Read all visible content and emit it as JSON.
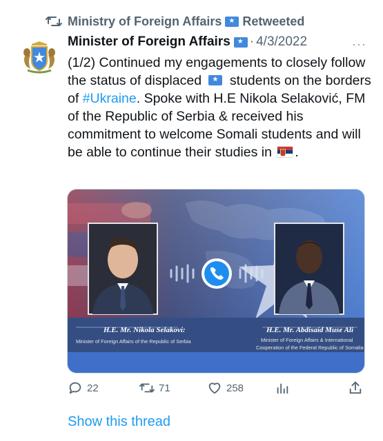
{
  "retweet": {
    "icon": "retweet-icon",
    "account": "Ministry of Foreign Affairs",
    "label": "Retweeted"
  },
  "tweet": {
    "author": "Minister of Foreign Affairs",
    "separator": "·",
    "date": "4/3/2022",
    "more": "···",
    "text_1": "(1/2) Continued my engagements to closely follow the status of displaced ",
    "text_2": " students on the borders of ",
    "hashtag": "#Ukraine",
    "text_3": ". Spoke with H.E Nikola Selaković, FM of the Republic of Serbia & received his commitment to welcome Somali students and will be able to continue their studies in ",
    "text_4": "."
  },
  "media": {
    "left_name": "H.E. Mr. Nikola Selakovi:",
    "left_title": "Minister of Foreign Affairs of the Republic of Serbia",
    "right_name": "H.E. Mr. Abdisaid Muse Ali",
    "right_title_1": "Minister of Foreign Affairs & International",
    "right_title_2": "Cooperation of the Federal Republic of Somalia"
  },
  "actions": {
    "replies": "22",
    "retweets": "71",
    "likes": "258"
  },
  "show_thread": "Show this thread",
  "colors": {
    "link": "#1d9bf0",
    "muted": "#536471",
    "somali_blue": "#4189dd"
  }
}
